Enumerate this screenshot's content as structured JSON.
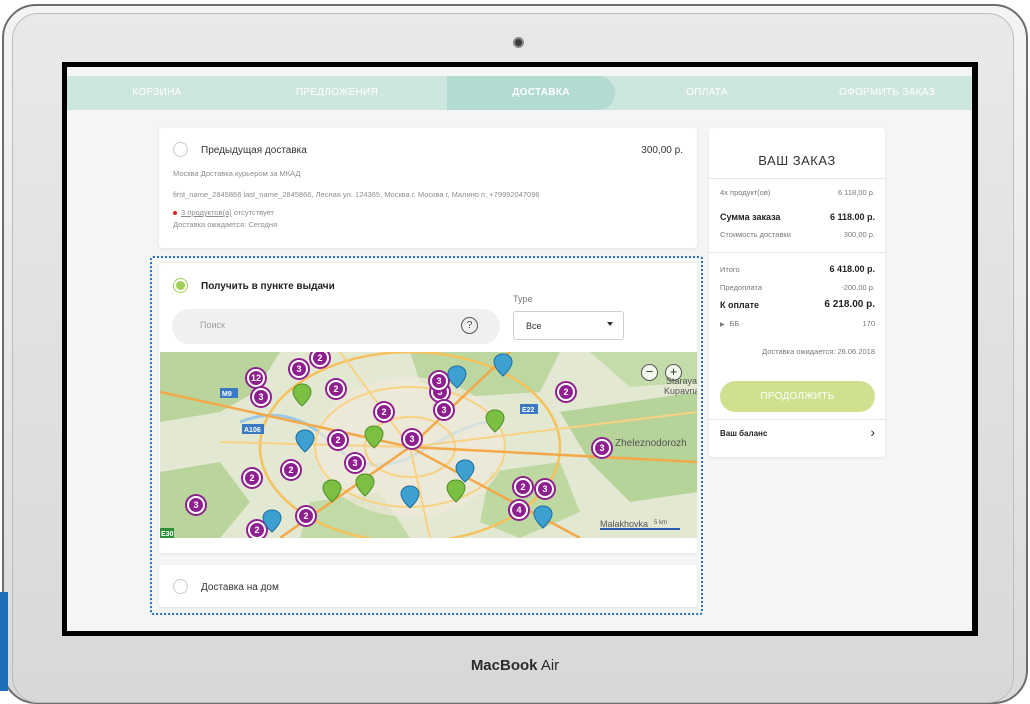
{
  "device": {
    "brand_bold": "MacBook",
    "brand_model": "Air"
  },
  "steps": [
    "КОРЗИНА",
    "ПРЕДЛОЖЕНИЯ",
    "ДОСТАВКА",
    "ОПЛАТА",
    "ОФОРМИТЬ ЗАКАЗ"
  ],
  "previous_delivery": {
    "title": "Предыдущая доставка",
    "price": "300,00 р.",
    "method": "Москва Доставка курьером за МКАД",
    "address": "first_name_2845866 last_name_2845866, Лесная ул. 124365, Москва г, Москва г, Малино п, +79992047096",
    "missing_link": "3 продуктов(а)",
    "missing_text": " отсутствует",
    "expected": "Доставка ожидается: Сегодня"
  },
  "pickup": {
    "title": "Получить в пункте выдачи",
    "search_placeholder": "Поиск",
    "help_glyph": "?",
    "type_label": "Type",
    "type_value": "Все"
  },
  "map": {
    "zoom_in": "+",
    "zoom_out": "−",
    "place_kupavna": "Staraya Kupavna",
    "place_zheleznodorozh": "Zheleznodorozh",
    "place_malakhovka": "Malakhovka",
    "scale": "5 km",
    "road_m9": "M9",
    "road_a106": "A106",
    "road_e22": "E22",
    "road_e30": "E30",
    "clusters": [
      "2",
      "3",
      "12",
      "3",
      "2",
      "2",
      "2",
      "3",
      "3",
      "2",
      "2",
      "3",
      "3",
      "3",
      "2",
      "3",
      "2",
      "3",
      "2",
      "4",
      "3",
      "2"
    ]
  },
  "home_delivery": {
    "title": "Доставка на дом"
  },
  "order": {
    "title": "ВАШ ЗАКАЗ",
    "products_label": "4x продукт(ов)",
    "products_value": "6 118,00 р.",
    "sum_label": "Сумма заказа",
    "sum_value": "6 118.00 р.",
    "delivery_cost_label": "Стоимость доставки",
    "delivery_cost_value": "300,00 р.",
    "total_label": "Итого",
    "total_value": "6 418.00 р.",
    "prepay_label": "Предоплата",
    "prepay_value": "-200,00 р.",
    "to_pay_label": "К оплате",
    "to_pay_value": "6 218.00 р.",
    "bb_label": "ББ",
    "bb_value": "170",
    "expected": "Доставка ожидается: 26.06.2018",
    "continue": "ПРОДОЛЖИТЬ",
    "balance": "Ваш баланс",
    "chevron": "›"
  }
}
